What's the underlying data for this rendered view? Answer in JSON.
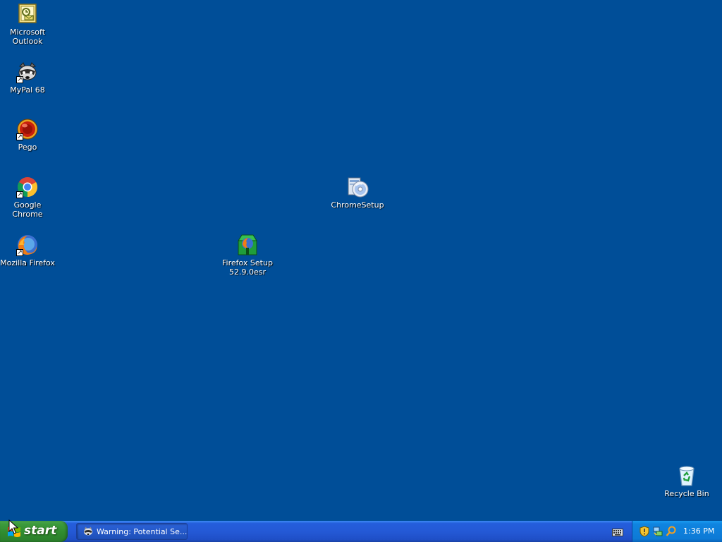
{
  "desktop": {
    "background": "#004e98",
    "icons": [
      {
        "name": "microsoft-outlook",
        "label": "Microsoft\nOutlook",
        "icon": "outlook-icon"
      },
      {
        "name": "mypal-68",
        "label": "MyPal 68",
        "icon": "raccoon-icon"
      },
      {
        "name": "pego",
        "label": "Pego",
        "icon": "red-orb-icon"
      },
      {
        "name": "google-chrome",
        "label": "Google Chrome",
        "icon": "chrome-icon"
      },
      {
        "name": "mozilla-firefox",
        "label": "Mozilla Firefox",
        "icon": "firefox-icon"
      },
      {
        "name": "firefox-setup",
        "label": "Firefox Setup\n52.9.0esr",
        "icon": "installer-icon"
      },
      {
        "name": "chrome-setup",
        "label": "ChromeSetup",
        "icon": "setup-cd-icon"
      },
      {
        "name": "recycle-bin",
        "label": "Recycle Bin",
        "icon": "recycle-bin-icon"
      }
    ]
  },
  "taskbar": {
    "start_label": "start",
    "tasks": [
      {
        "label": "Warning: Potential Se...",
        "icon": "raccoon-icon"
      }
    ],
    "tray": {
      "icons": [
        "keyboard-icon",
        "security-shield-icon",
        "network-icon",
        "search-icon"
      ],
      "clock": "1:36 PM"
    },
    "colors": {
      "bar": "#245edc",
      "start": "#3c9a3c",
      "tray": "#0f84e0"
    }
  }
}
